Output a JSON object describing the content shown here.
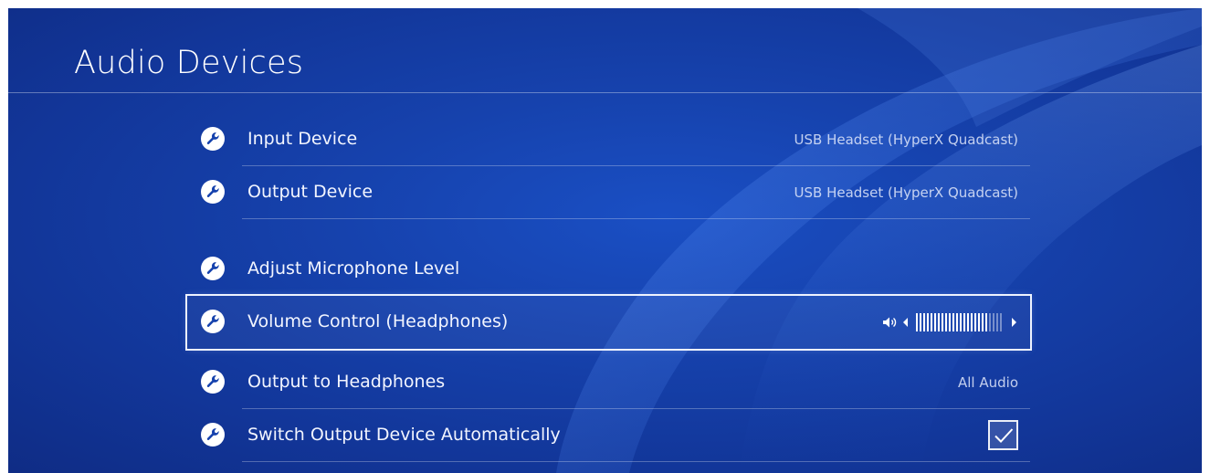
{
  "header": {
    "title": "Audio Devices"
  },
  "rows": [
    {
      "label": "Input Device",
      "value": "USB Headset (HyperX Quadcast)",
      "icon": "wrench-icon"
    },
    {
      "label": "Output Device",
      "value": "USB Headset (HyperX Quadcast)",
      "icon": "wrench-icon"
    },
    {
      "label": "Adjust Microphone Level",
      "value": "",
      "icon": "wrench-icon"
    },
    {
      "label": "Volume Control (Headphones)",
      "icon": "wrench-icon",
      "volume": {
        "level": 20,
        "max": 24
      }
    },
    {
      "label": "Output to Headphones",
      "value": "All Audio",
      "icon": "wrench-icon"
    },
    {
      "label": "Switch Output Device Automatically",
      "icon": "wrench-icon",
      "checked": true
    }
  ],
  "colors": {
    "background": "#1642ad",
    "focus_outline": "#eef3ff",
    "text": "#ffffff"
  }
}
